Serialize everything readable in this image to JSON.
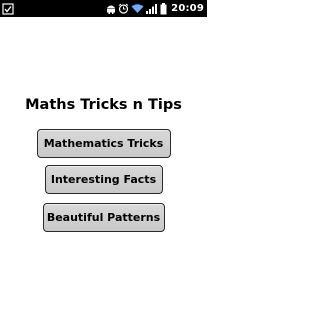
{
  "status_bar": {
    "time": "20:09",
    "icons": [
      "usb-debug-icon",
      "android-icon",
      "alarm-icon",
      "wifi-icon",
      "signal-icon",
      "battery-icon"
    ]
  },
  "app": {
    "title": "Maths Tricks n Tips",
    "buttons": [
      {
        "label": "Mathematics Tricks"
      },
      {
        "label": "Interesting Facts"
      },
      {
        "label": "Beautiful Patterns"
      }
    ]
  },
  "colors": {
    "status_bar_bg": "#000000",
    "background": "#ffffff",
    "button_bg": "#d0d0d0",
    "button_border": "#2a2a2a"
  }
}
